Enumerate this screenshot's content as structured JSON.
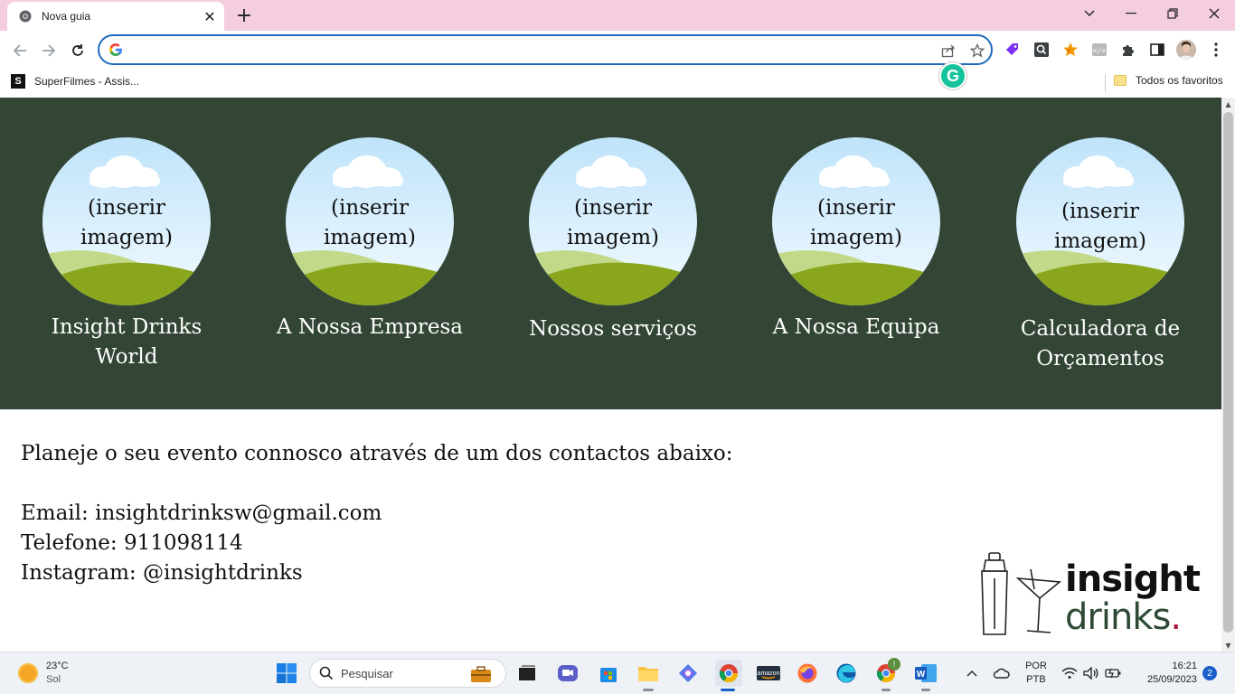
{
  "browser": {
    "tab": {
      "title": "Nova guia",
      "close_label": "✕"
    },
    "new_tab_label": "+",
    "omnibox": {
      "value": "",
      "placeholder": ""
    },
    "bookmarks": [
      {
        "label": "SuperFilmes - Assis...",
        "icon_letter": "S"
      }
    ],
    "all_bookmarks_label": "Todos os favoritos",
    "grammarly_letter": "G"
  },
  "page": {
    "colors": {
      "hero_bg": "#334636",
      "accent": "#b0173a"
    },
    "cards": [
      {
        "placeholder_line1": "(inserir",
        "placeholder_line2": "imagem)",
        "label_line1": "Insight Drinks",
        "label_line2": "World"
      },
      {
        "placeholder_line1": "(inserir",
        "placeholder_line2": "imagem)",
        "label_line1": "A Nossa Empresa",
        "label_line2": ""
      },
      {
        "placeholder_line1": "(inserir",
        "placeholder_line2": "imagem)",
        "label_line1": "Nossos serviços",
        "label_line2": ""
      },
      {
        "placeholder_line1": "(inserir",
        "placeholder_line2": "imagem)",
        "label_line1": "A Nossa Equipa",
        "label_line2": ""
      },
      {
        "placeholder_line1": "(inserir",
        "placeholder_line2": "imagem)",
        "label_line1": "Calculadora de",
        "label_line2": "Orçamentos"
      }
    ],
    "contact": {
      "intro": "Planeje o seu evento connosco através de um dos contactos abaixo:",
      "email": "Email: insightdrinksw@gmail.com",
      "phone": "Telefone: 911098114",
      "instagram": "Instagram: @insightdrinks"
    },
    "logo": {
      "word1": "insight",
      "word2": "drinks",
      "dot": "."
    }
  },
  "taskbar": {
    "weather": {
      "temp": "23°C",
      "condition": "Sol"
    },
    "search_placeholder": "Pesquisar",
    "language": {
      "line1": "POR",
      "line2": "PTB"
    },
    "clock": {
      "time": "16:21",
      "date": "25/09/2023"
    },
    "notification_count": "2",
    "chrome_badge": "!"
  }
}
